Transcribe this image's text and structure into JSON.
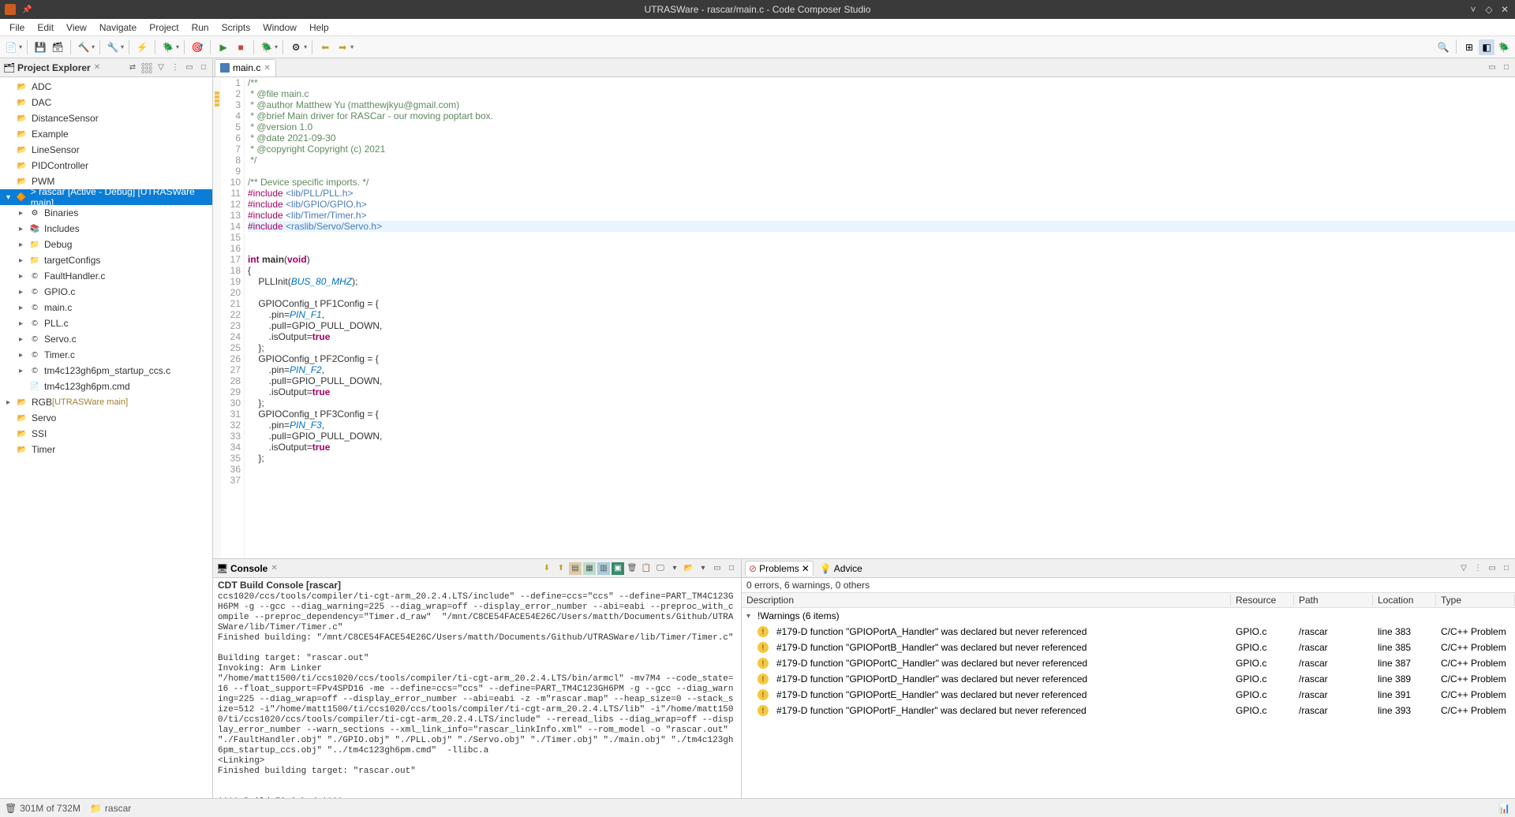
{
  "title": "UTRASWare - rascar/main.c - Code Composer Studio",
  "menu": [
    "File",
    "Edit",
    "View",
    "Navigate",
    "Project",
    "Run",
    "Scripts",
    "Window",
    "Help"
  ],
  "projectExplorer": {
    "title": "Project Explorer",
    "items": [
      {
        "label": "ADC",
        "lvl": 1,
        "icon": "folder"
      },
      {
        "label": "DAC",
        "lvl": 1,
        "icon": "folder"
      },
      {
        "label": "DistanceSensor",
        "lvl": 1,
        "icon": "folder"
      },
      {
        "label": "Example",
        "lvl": 1,
        "icon": "folder"
      },
      {
        "label": "LineSensor",
        "lvl": 1,
        "icon": "folder"
      },
      {
        "label": "PIDController",
        "lvl": 1,
        "icon": "folder"
      },
      {
        "label": "PWM",
        "lvl": 1,
        "icon": "folder"
      },
      {
        "label": "> rascar  [Active - Debug] [UTRASWare main]",
        "lvl": 1,
        "icon": "proj",
        "selected": true,
        "expanded": true
      },
      {
        "label": "Binaries",
        "lvl": 2,
        "icon": "bin",
        "tw": "▸"
      },
      {
        "label": "Includes",
        "lvl": 2,
        "icon": "inc",
        "tw": "▸"
      },
      {
        "label": "Debug",
        "lvl": 2,
        "icon": "dbg",
        "tw": "▸"
      },
      {
        "label": "targetConfigs",
        "lvl": 2,
        "icon": "cfg",
        "tw": "▸"
      },
      {
        "label": "FaultHandler.c",
        "lvl": 2,
        "icon": "c",
        "tw": "▸"
      },
      {
        "label": "GPIO.c",
        "lvl": 2,
        "icon": "c",
        "tw": "▸"
      },
      {
        "label": "main.c",
        "lvl": 2,
        "icon": "c",
        "tw": "▸"
      },
      {
        "label": "PLL.c",
        "lvl": 2,
        "icon": "c",
        "tw": "▸"
      },
      {
        "label": "Servo.c",
        "lvl": 2,
        "icon": "c",
        "tw": "▸"
      },
      {
        "label": "Timer.c",
        "lvl": 2,
        "icon": "c",
        "tw": "▸"
      },
      {
        "label": "tm4c123gh6pm_startup_ccs.c",
        "lvl": 2,
        "icon": "c",
        "tw": "▸"
      },
      {
        "label": "tm4c123gh6pm.cmd",
        "lvl": 2,
        "icon": "cmd",
        "tw": ""
      },
      {
        "label": "RGB",
        "lvl": 1,
        "icon": "folder",
        "decor": " [UTRASWare main]",
        "tw": "▸"
      },
      {
        "label": "Servo",
        "lvl": 1,
        "icon": "folder"
      },
      {
        "label": "SSI",
        "lvl": 1,
        "icon": "folder"
      },
      {
        "label": "Timer",
        "lvl": 1,
        "icon": "folder"
      }
    ]
  },
  "editor": {
    "tabname": "main.c",
    "lines": [
      {
        "n": 1,
        "t": "/**",
        "cls": "c-comment"
      },
      {
        "n": 2,
        "t": " * @file main.c",
        "cls": "c-comment"
      },
      {
        "n": 3,
        "t": " * @author Matthew Yu (matthewjkyu@gmail.com)",
        "cls": "c-comment"
      },
      {
        "n": 4,
        "t": " * @brief Main driver for RASCar - our moving poptart box.",
        "cls": "c-comment"
      },
      {
        "n": 5,
        "t": " * @version 1.0",
        "cls": "c-comment"
      },
      {
        "n": 6,
        "t": " * @date 2021-09-30",
        "cls": "c-comment"
      },
      {
        "n": 7,
        "t": " * @copyright Copyright (c) 2021",
        "cls": "c-comment"
      },
      {
        "n": 8,
        "t": " */",
        "cls": "c-comment"
      },
      {
        "n": 9,
        "t": ""
      },
      {
        "n": 10,
        "t": "/** Device specific imports. */",
        "cls": "c-comment"
      },
      {
        "n": 11,
        "html": "<span class='c-include'>#include</span> <span class='c-string'>&lt;lib/PLL/PLL.h&gt;</span>"
      },
      {
        "n": 12,
        "html": "<span class='c-include'>#include</span> <span class='c-string'>&lt;lib/GPIO/GPIO.h&gt;</span>"
      },
      {
        "n": 13,
        "html": "<span class='c-include'>#include</span> <span class='c-string'>&lt;lib/Timer/Timer.h&gt;</span>"
      },
      {
        "n": 14,
        "html": "<span class='c-include'>#include</span> <span class='c-string'>&lt;raslib/Servo/Servo.h&gt;</span>",
        "hl": true
      },
      {
        "n": 15,
        "t": ""
      },
      {
        "n": 16,
        "t": ""
      },
      {
        "n": 17,
        "html": "<span class='c-keyword'>int</span> <b>main</b>(<span class='c-keyword'>void</span>)"
      },
      {
        "n": 18,
        "t": "{"
      },
      {
        "n": 19,
        "html": "    PLLInit(<span class='c-const'>BUS_80_MHZ</span>);"
      },
      {
        "n": 20,
        "t": ""
      },
      {
        "n": 21,
        "html": "    GPIOConfig_t PF1Config = {"
      },
      {
        "n": 22,
        "html": "        .pin=<span class='c-const'>PIN_F1</span>,"
      },
      {
        "n": 23,
        "html": "        .pull=GPIO_PULL_DOWN,"
      },
      {
        "n": 24,
        "html": "        .isOutput=<span class='c-bool'>true</span>"
      },
      {
        "n": 25,
        "t": "    };"
      },
      {
        "n": 26,
        "html": "    GPIOConfig_t PF2Config = {"
      },
      {
        "n": 27,
        "html": "        .pin=<span class='c-const'>PIN_F2</span>,"
      },
      {
        "n": 28,
        "html": "        .pull=GPIO_PULL_DOWN,"
      },
      {
        "n": 29,
        "html": "        .isOutput=<span class='c-bool'>true</span>"
      },
      {
        "n": 30,
        "t": "    };"
      },
      {
        "n": 31,
        "html": "    GPIOConfig_t PF3Config = {"
      },
      {
        "n": 32,
        "html": "        .pin=<span class='c-const'>PIN_F3</span>,"
      },
      {
        "n": 33,
        "html": "        .pull=GPIO_PULL_DOWN,"
      },
      {
        "n": 34,
        "html": "        .isOutput=<span class='c-bool'>true</span>"
      },
      {
        "n": 35,
        "t": "    };"
      },
      {
        "n": 36,
        "t": ""
      },
      {
        "n": 37,
        "t": ""
      }
    ]
  },
  "console": {
    "title": "Console",
    "subtitle": "CDT Build Console [rascar]",
    "text": "ccs1020/ccs/tools/compiler/ti-cgt-arm_20.2.4.LTS/include\" --define=ccs=\"ccs\" --define=PART_TM4C123GH6PM -g --gcc --diag_warning=225 --diag_wrap=off --display_error_number --abi=eabi --preproc_with_compile --preproc_dependency=\"Timer.d_raw\"  \"/mnt/C8CE54FACE54E26C/Users/matth/Documents/Github/UTRASWare/lib/Timer/Timer.c\"\nFinished building: \"/mnt/C8CE54FACE54E26C/Users/matth/Documents/Github/UTRASWare/lib/Timer/Timer.c\"\n \nBuilding target: \"rascar.out\"\nInvoking: Arm Linker\n\"/home/matt1500/ti/ccs1020/ccs/tools/compiler/ti-cgt-arm_20.2.4.LTS/bin/armcl\" -mv7M4 --code_state=16 --float_support=FPv4SPD16 -me --define=ccs=\"ccs\" --define=PART_TM4C123GH6PM -g --gcc --diag_warning=225 --diag_wrap=off --display_error_number --abi=eabi -z -m\"rascar.map\" --heap_size=0 --stack_size=512 -i\"/home/matt1500/ti/ccs1020/ccs/tools/compiler/ti-cgt-arm_20.2.4.LTS/lib\" -i\"/home/matt1500/ti/ccs1020/ccs/tools/compiler/ti-cgt-arm_20.2.4.LTS/include\" --reread_libs --diag_wrap=off --display_error_number --warn_sections --xml_link_info=\"rascar_linkInfo.xml\" --rom_model -o \"rascar.out\" \"./FaultHandler.obj\" \"./GPIO.obj\" \"./PLL.obj\" \"./Servo.obj\" \"./Timer.obj\" \"./main.obj\" \"./tm4c123gh6pm_startup_ccs.obj\" \"../tm4c123gh6pm.cmd\"  -llibc.a \n<Linking>\nFinished building target: \"rascar.out\"\n \n\n**** Build Finished ****"
  },
  "problems": {
    "tab1": "Problems",
    "tab2": "Advice",
    "summary": "0 errors, 6 warnings, 0 others",
    "cols": {
      "desc": "Description",
      "res": "Resource",
      "path": "Path",
      "loc": "Location",
      "type": "Type"
    },
    "group": "Warnings (6 items)",
    "rows": [
      {
        "desc": "#179-D function \"GPIOPortA_Handler\" was declared but never referenced",
        "res": "GPIO.c",
        "path": "/rascar",
        "loc": "line 383",
        "type": "C/C++ Problem"
      },
      {
        "desc": "#179-D function \"GPIOPortB_Handler\" was declared but never referenced",
        "res": "GPIO.c",
        "path": "/rascar",
        "loc": "line 385",
        "type": "C/C++ Problem"
      },
      {
        "desc": "#179-D function \"GPIOPortC_Handler\" was declared but never referenced",
        "res": "GPIO.c",
        "path": "/rascar",
        "loc": "line 387",
        "type": "C/C++ Problem"
      },
      {
        "desc": "#179-D function \"GPIOPortD_Handler\" was declared but never referenced",
        "res": "GPIO.c",
        "path": "/rascar",
        "loc": "line 389",
        "type": "C/C++ Problem"
      },
      {
        "desc": "#179-D function \"GPIOPortE_Handler\" was declared but never referenced",
        "res": "GPIO.c",
        "path": "/rascar",
        "loc": "line 391",
        "type": "C/C++ Problem"
      },
      {
        "desc": "#179-D function \"GPIOPortF_Handler\" was declared but never referenced",
        "res": "GPIO.c",
        "path": "/rascar",
        "loc": "line 393",
        "type": "C/C++ Problem"
      }
    ]
  },
  "status": {
    "heap": "301M of 732M",
    "proj": "rascar"
  }
}
